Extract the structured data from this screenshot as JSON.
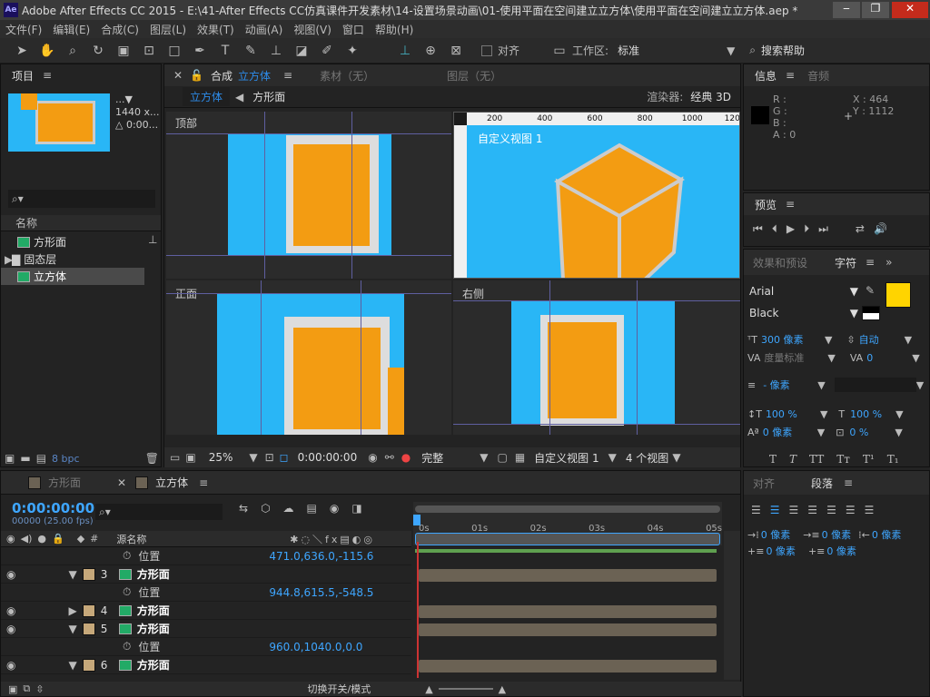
{
  "app": {
    "title": "Adobe After Effects CC 2015 - E:\\41-After Effects CC仿真课件开发素材\\14-设置场景动画\\01-使用平面在空间建立立方体\\使用平面在空间建立立方体.aep *",
    "logo": "Ae"
  },
  "menu": [
    "文件(F)",
    "编辑(E)",
    "合成(C)",
    "图层(L)",
    "效果(T)",
    "动画(A)",
    "视图(V)",
    "窗口",
    "帮助(H)"
  ],
  "toolbar": {
    "align_label": "对齐",
    "workspace_label": "工作区:",
    "workspace_value": "标准",
    "search_placeholder": "搜索帮助"
  },
  "project": {
    "tab": "项目",
    "thumb_info1": "...▼",
    "thumb_info2": "1440 x...",
    "thumb_info3": "△ 0:00...",
    "col_name": "名称",
    "items": [
      "方形面",
      "固态层",
      "立方体"
    ],
    "bpc": "8 bpc"
  },
  "comp": {
    "tab_label": "合成",
    "tab_name": "立方体",
    "footage": "素材（无）",
    "layer": "图层（无）",
    "breadcrumb_active": "立方体",
    "breadcrumb_next": "方形面",
    "renderer_label": "渲染器:",
    "renderer_value": "经典 3D",
    "views": {
      "top": "顶部",
      "custom": "自定义视图 1",
      "front": "正面",
      "right": "右侧"
    },
    "ruler": [
      "200",
      "400",
      "600",
      "800",
      "1000",
      "1200"
    ],
    "zoom": "25%",
    "timecode": "0:00:00:00",
    "quality": "完整",
    "active_view": "自定义视图 1",
    "view_count": "4 个视图"
  },
  "info": {
    "tab": "信息",
    "tab2": "音频",
    "r": "R :",
    "g": "G :",
    "b": "B :",
    "a": "A : 0",
    "x": "X : 464",
    "y": "Y : 1112"
  },
  "preview": {
    "tab": "预览"
  },
  "effects": {
    "tab": "效果和预设",
    "char_tab": "字符"
  },
  "character": {
    "font": "Arial",
    "style": "Black",
    "size": "300 像素",
    "leading": "自动",
    "kerning": "度量标准",
    "tracking": "0",
    "stroke": "- 像素",
    "vscale": "100 %",
    "hscale": "100 %",
    "baseline": "0 像素",
    "tsume": "0 %",
    "fill_color": "#ffd400"
  },
  "paragraph": {
    "tab": "对齐",
    "tab2": "段落",
    "indent_left": "0 像素",
    "indent_first": "0 像素",
    "indent_right": "0 像素",
    "space_before": "0 像素",
    "space_after": "0 像素"
  },
  "timeline": {
    "tab1": "方形面",
    "tab2": "立方体",
    "timecode": "0:00:00:00",
    "fps": "00000 (25.00 fps)",
    "col_source": "源名称",
    "ticks": [
      "0s",
      "01s",
      "02s",
      "03s",
      "04s",
      "05s"
    ],
    "layers": [
      {
        "kind": "prop",
        "name": "位置",
        "value": "471.0,636.0,-115.6"
      },
      {
        "kind": "layer",
        "num": "3",
        "name": "方形面"
      },
      {
        "kind": "prop",
        "name": "位置",
        "value": "944.8,615.5,-548.5"
      },
      {
        "kind": "layer",
        "num": "4",
        "name": "方形面"
      },
      {
        "kind": "layer",
        "num": "5",
        "name": "方形面"
      },
      {
        "kind": "prop",
        "name": "位置",
        "value": "960.0,1040.0,0.0"
      },
      {
        "kind": "layer",
        "num": "6",
        "name": "方形面"
      }
    ],
    "bottom_label": "切换开关/模式"
  },
  "colors": {
    "accent": "#2d8ceb",
    "cube_orange": "#f39c12",
    "sky_blue": "#29b6f6"
  }
}
